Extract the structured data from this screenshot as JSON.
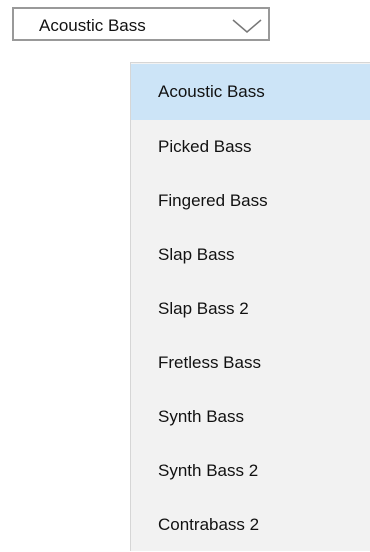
{
  "combo": {
    "selected_label": "Acoustic Bass",
    "chevron_icon": "chevron-down-icon"
  },
  "dropdown": {
    "selected_index": 0,
    "highlight_color": "#cce4f7",
    "items": [
      {
        "label": "Acoustic Bass"
      },
      {
        "label": "Picked Bass"
      },
      {
        "label": "Fingered Bass"
      },
      {
        "label": "Slap Bass"
      },
      {
        "label": "Slap Bass 2"
      },
      {
        "label": "Fretless Bass"
      },
      {
        "label": "Synth Bass"
      },
      {
        "label": "Synth Bass 2"
      },
      {
        "label": "Contrabass 2"
      }
    ]
  }
}
